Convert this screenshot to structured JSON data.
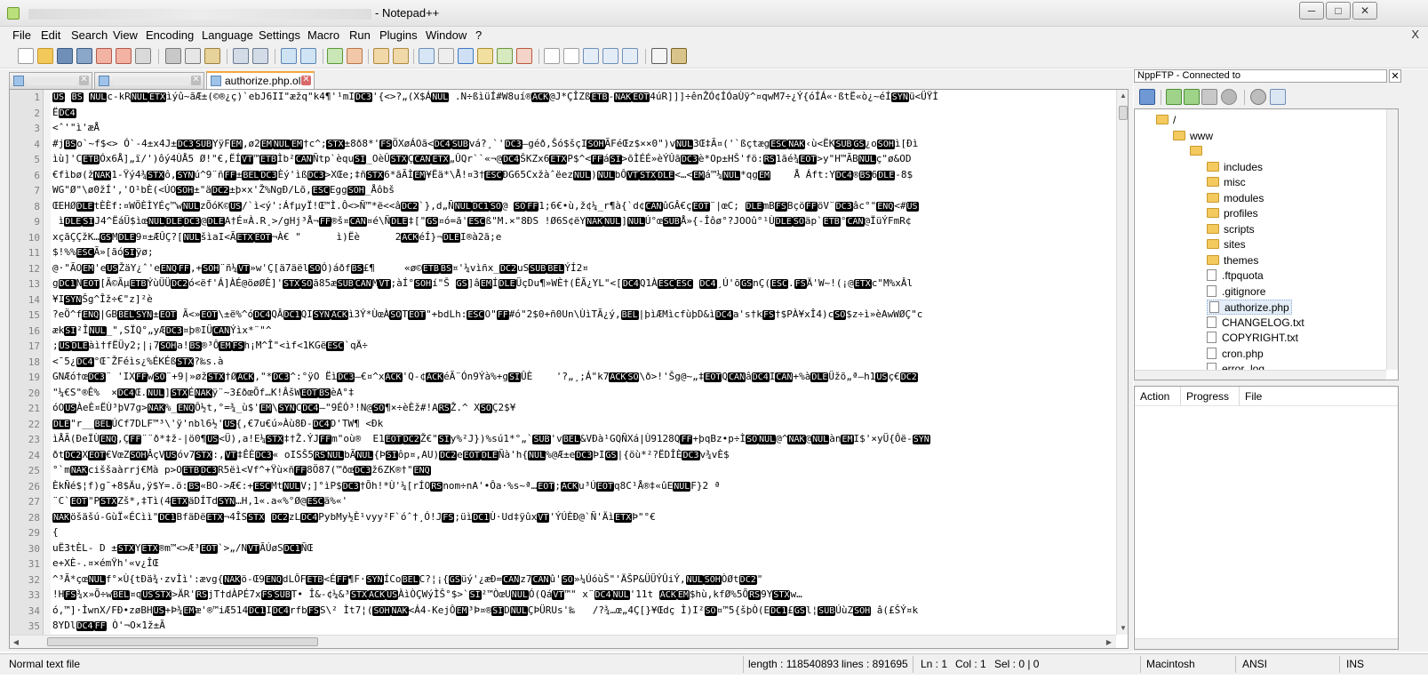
{
  "window": {
    "title_suffix": "- Notepad++",
    "controls": {
      "minimize": "─",
      "maximize": "□",
      "close": "✕"
    }
  },
  "menu": {
    "items": [
      "File",
      "Edit",
      "Search",
      "View",
      "Encoding",
      "Language",
      "Settings",
      "Macro",
      "Run",
      "Plugins",
      "Window",
      "?"
    ],
    "close": "X"
  },
  "toolbar": {
    "icons": [
      "new-file-icon",
      "open-file-icon",
      "save-icon",
      "save-all-icon",
      "close-icon",
      "close-all-icon",
      "print-icon",
      "cut-icon",
      "copy-icon",
      "paste-icon",
      "undo-icon",
      "redo-icon",
      "find-icon",
      "replace-icon",
      "zoom-in-icon",
      "zoom-out-icon",
      "sync-vertical-icon",
      "sync-horizontal-icon",
      "word-wrap-icon",
      "show-all-chars-icon",
      "indent-guide-icon",
      "doc-map-icon",
      "function-list-icon",
      "folder-workspace-icon",
      "monitoring-icon",
      "record-macro-icon",
      "stop-macro-icon",
      "play-macro-icon",
      "run-macro-multiple-icon",
      "save-macro-icon",
      "spellcheck-icon",
      "ftp-icon"
    ]
  },
  "tabs": [
    {
      "label": "",
      "close": "✕",
      "active": false
    },
    {
      "label": "",
      "close": "✕",
      "active": false
    },
    {
      "label": "authorize.php.old",
      "close": "✕",
      "active": true
    }
  ],
  "editor": {
    "lines": [
      {
        "n": "1",
        "t": "US BS NULc-kRNULETXìýû~ãÆ±(©®¿ç)`ebJ6II\"æžq\"k4¶'¹mIDC3'{<>?„(X$ÁNUL .N÷ßìüÍ#W8uí®ACK@J*ÇÎZßETB-NAKEOT4úR]]]÷ênŽÓ¢ÍÓaÙÿ^¤qwM7÷¿Ý{óÍÁ«·ßtË«ò¿~éÍSYNü<ÜŸÌ"
      },
      {
        "n": "2",
        "t": "ËDC4"
      },
      {
        "n": "3",
        "t": "<ˆ'\"ì'æÅ"
      },
      {
        "n": "4",
        "t": "#jBSo`~f$<> Ó`-4±x4J±DC3SUBYÿFEM,ø2EMNULEM†c^;STX±8ð8*'FSÖXøÁOã<DC4SUBvá?¸`'DC3—géð,Šó$šçISOHÃFéŒz$××0\")vNUL3Œ‡Ã¤('`ßçtægESCNAK‹ù<ËKSUBGS¿oSOHì[Ðì"
      },
      {
        "n": "5",
        "t": "ìù]'CETBÓx6Å]„ï/')ôý4ÙÅ5 Ø!\"€,ËÍVT™ETBÌb²CANÑtp`èquSI_OèÛSTXÇCANETX„ÛQr``«¬@DC4ŠKZx6ETXP$^<FFáSI>õÌÉÉ»èÝÛãDC3è*Op±HŠ'fö:RS1ãé¾EOT>y\"H™ÃBNULç\"ø&OD"
      },
      {
        "n": "6",
        "t": "€fìbø(žNAK1-Ÿý4¾STXô,SYNú^9¨ñFF±BELDC3Èý'ìßDC3>XŒe;‡ñSTX6*ãÃÌEM¥Ëä*\\Å!¤3†ESCĐG65CxžàˆëezNUL)NULbÔVTSTXDLE<…<EMá™¼NUL*qgEM    Å Áft:YDC4®BS6DLE-8$"
      },
      {
        "n": "7",
        "t": "WG\"Ø\"\\ø0žÍ'‚'O¹bÈ(<ÚOSOH±\"äDC2±þ×x'Ž%NgÐ/Lõ,ESCEggSOH_Åôbš"
      },
      {
        "n": "8",
        "t": "ŒEHØDLEtÈÈf:¤WÖÈÌYÉç™wNULzÕóK©US/`ì<ý':ÁfµyÏ!Œ™Ì.Ô<>Ñ™*ë<<âDC2`},d„ÑNULDC1SO@ SOFF1;6€•ù,ž¢¼_r¶à{`d¢CANûGÂ€çEOT¨|œC; DLEmBFSBçöFFöV¨DC3âc°\"ENQ<#US"
      },
      {
        "n": "9",
        "t": " ìDLESIJ4^ËáÜ$ìœNULDLEDC3@DLEA†É¤À.R¸>/gHj³Å¬FF®š¤CAN¤é\\ÑDLE‡[\"GS¤ó=ã'ESCß\"M.×\"8ÐS !Ø6S¢ëYNAKNUL]NULÚ°œSUBÅ»{-Îôø°?JOOû°¹ÙDLESOäp`ETB°CAN@ÏüÝFmR¢"
      },
      {
        "n": "10",
        "t": "xçãÇÇžK…GSMDLE9¤±ÆÛÇ?[NULšìaI<ÃETXEOT¬À€ \"      ì)Ëè      2ACKéÍ}¬DLEI®à2ã;e"
      },
      {
        "n": "11",
        "t": "$!%%ESCÃ»[ãóSIÿø; "
      },
      {
        "n": "12",
        "t": "@·\"ÃOEM'eUSŽäY¿ˆ'eENQFF,+SOH¨ñ¼VT»w'Ç[ä7äëlSOÓ)áðfBS£¶     «ø©ETBBS¤'¼vìñx_DC2uSSUBBELÝÍ2¤"
      },
      {
        "n": "13",
        "t": "gDC1NEOT[Ã©ÃµETBÝùÜÜDC2ó<ëf'Á]ÀÉ@öøØÈ]'STXSOã85æSUBCANMVT;àÍ°SOHí\"Š GS]âEMÍDLEÜçDu¶»WÈ†(ËÃ¿YL\"<[DC4Q1ÀESCESC DC4¸Ú'õGSnÇ(ESC.FSÄ'W~!(¡@ETXc\"M%xÂl"
      },
      {
        "n": "14",
        "t": "¥ISYNŠg^Îž÷€\"z]²è"
      },
      {
        "n": "15",
        "t": "?eÖ^fENQ|GBBELSYN±EOT Ã<»EOT\\±ë%^óDC4QÂDC1QISYNACKì3Ý*ÙœÀSOTEOT\"+bdLh:ESCO\"FF#ó\"2$0+ñ0Un\\ÙìTÃ¿ý,BEL|þìÆMìcfùþD&ìDC4a's†kFS†$PÀ¥xÎ4)cSO$z÷ì»èAwWØÇ\"c"
      },
      {
        "n": "16",
        "t": "ækSI²ÎNUL_\",SÏQ°„yÆDC3¤þ®IÜCANÝìx*¨\"^"
      },
      {
        "n": "17",
        "t": ";USDLEàì†fËÜy2;|¡7SOHa!BS®³ÔEMFSh¡M^Î\"<ìf<1KGëESC`qÄ÷"
      },
      {
        "n": "18",
        "t": "<¯5¿DC4°Œ¯ŽFéìs¿%ÉKÉßSTX?‰s.à"
      },
      {
        "n": "19",
        "t": "GNÆó†œDC3¨ 'IXFFwSO¨+9|»øžSTX†ØACK,\"*DC3^:°ÿO ËìDC3—€¤^xACK'Q-¢ACKéÃ¨Ón9Ýà%+gSIÛÈ    '?„¸;Á\"k7ACKSO\\ð>!'Šg@~„‡EOTQCANâDC4ICAN+%àDLEÜžõ„ª—h1USç€DC2"
      },
      {
        "n": "20",
        "t": "\"¼€S\"®Ê%  ×DC4Œ.NUL]STXÉNAKÿ¨~3£ðœÕf…K!ÂšWEOTBSèA°‡"
      },
      {
        "n": "21",
        "t": "óOUSÀeÈ¤ËÙ³þV7g>NAK%_ENQÔ½t,°=¾_ù$'EM\\SYNCDC4—\"9ÉÓ³!N@SO¶×÷èÈž#!ARSŽ.^ XSOÇ2$¥"
      },
      {
        "n": "22",
        "t": "DLE\"r__BELÚCf7DLF™³\\'ÿ'nbl6½'US{,€7u€ú»Àù8Ð-DC4D'TW¶ <Ðk"
      },
      {
        "n": "23",
        "t": "ìÅÃ(ÐeÏÙENQ,ÇFF¨¨ð*‡ž-|ö0¶US<Ü),a!E¼STX‡†Ž.ÝJFFm\"où®  E1EOTDC2Ž€\"SIy%²J})%sú1*°„`SUB'vBEL&VÐà¹GQÑXá|Ù9128QFF+þqBz•p÷ÌSONUL@^NAK@NULànEMI$'×yÜ{Ôë-SYN"
      },
      {
        "n": "24",
        "t": "ðtDC2XEOT€VœZSOHÂçVUSóv7STX:,VT‡ÊÈDC3« oISŠ5RSNULbÃNUL{ÞSIôp¤,AU)DC2eEOTDLEÑà'h{NUL%@Æ±eDC3ÞIGS|{öù*²?ËDÎÈDC3v¾vÈ$"
      },
      {
        "n": "25",
        "t": "°`mNAKciššaàrrj€Mà p>OETBDC3R5ëì<Vf^+Ÿù×ñFF8Ö87(™ðœDC3ž6ZK®†\"ENQ"
      },
      {
        "n": "26",
        "t": "ÈkÑé$¦f)g¯+8$Äu,ÿ$Y=.ö:BS«BO->Æ€:+ESCMtNULV;]°ìP$DC3†Õh!*Ù'¼[rÍORSnom÷nA'•Ôa·%s~ª…EOT;ACKu³ÚEOTq8C¹Å®‡«ûENULF}2 ª"
      },
      {
        "n": "27",
        "t": "¨C`EOT\"PSTXZš*,‡Tì(4ETXäDÍTdSYN…H,1«.a«%°Ø@ESCä%«'"
      },
      {
        "n": "28",
        "t": "NAKöšäšú-GùÏ«ÉCìì\"DC1BfäÐëETX¬4ÎSSTX DC2zLDC4PybMy½È¹vyy²F`óˆ†¸Ó!JFS;üìDC1Ù·Ud‡ÿûxVT'ÝÚÈÐ@`Ñ'ÄìETXÞ\"°€"
      },
      {
        "n": "29",
        "t": "{"
      },
      {
        "n": "30",
        "t": "uË3tÈL- D ±STXYETX®m™<>Æ³EOT`>„/NVTÃÚøSDC1ÑŒ"
      },
      {
        "n": "31",
        "t": "e+XÈ-.¤×émŸh'«v¿ÎŒ"
      },
      {
        "n": "32",
        "t": "^³Ã*çœNULf°×Ù{tÐä¾·zvÌì':ævg{NAKö-Œ9ENQdLÔFETB<ÉFF¶F·SYNÍCoBELC?¦¡{GSüý'¿æÐ=CANz7CANû'SO»¼ÚóùŠ\"'ÄŠP&ÜÜÝÛiÝ,NULSOHÒØtDC2\""
      },
      {
        "n": "33",
        "t": "!HFS¾x»Õ÷wBEL¤qUSSTX>ÄR'RSjT†dÀPÉ7xFSSUBT• Î&-¢¼&³STXACKUSÀìÒÇWýÌŠ°$>`SI²™ÒœUNULÓ(QáVT™\" x¨DC4NUL'11t ACKEM$hù,kfØ%5ÕRS9YSTXw…"
      },
      {
        "n": "34",
        "t": "ó,™]·ÌwnX/FÐ•zøBHUS+Þ¾EMæ'®™iÆ514DC1IDC4rfbFSS\\² Ìt7¦(SOHNAK<Á4-KejÔEM³Þ¤®SIDNULÇÞÜRUs'‰   /?¾…œ„4Ç[}¥Œdç Ì)I²SO¤™5{šþÒ(EDC1£GSl¦SUBÚùZSOH â(£ŠÝ¤k"
      },
      {
        "n": "35",
        "t": "8YDlDC4FF Ò'¬O×1ž±Ã"
      }
    ]
  },
  "ftp": {
    "header": "NppFTP - Connected to",
    "close": "✕",
    "toolbar_icons": [
      "connect-icon",
      "download-icon",
      "upload-icon",
      "refresh-icon",
      "abort-icon",
      "settings-icon",
      "message-window-icon"
    ],
    "tree": [
      {
        "label": "/",
        "type": "folder",
        "depth": 0
      },
      {
        "label": "www",
        "type": "folder",
        "depth": 1
      },
      {
        "label": "",
        "type": "folder",
        "depth": 2
      },
      {
        "label": "includes",
        "type": "folder",
        "depth": 3
      },
      {
        "label": "misc",
        "type": "folder",
        "depth": 3
      },
      {
        "label": "modules",
        "type": "folder",
        "depth": 3
      },
      {
        "label": "profiles",
        "type": "folder",
        "depth": 3
      },
      {
        "label": "scripts",
        "type": "folder",
        "depth": 3
      },
      {
        "label": "sites",
        "type": "folder",
        "depth": 3
      },
      {
        "label": "themes",
        "type": "folder",
        "depth": 3
      },
      {
        "label": ".ftpquota",
        "type": "file",
        "depth": 3
      },
      {
        "label": ".gitignore",
        "type": "file",
        "depth": 3
      },
      {
        "label": "authorize.php",
        "type": "file",
        "depth": 3,
        "selected": true
      },
      {
        "label": "CHANGELOG.txt",
        "type": "file",
        "depth": 3
      },
      {
        "label": "COPYRIGHT.txt",
        "type": "file",
        "depth": 3
      },
      {
        "label": "cron.php",
        "type": "file",
        "depth": 3
      },
      {
        "label": "error_log",
        "type": "file",
        "depth": 3
      }
    ],
    "queue_headers": [
      "Action",
      "Progress",
      "File"
    ]
  },
  "statusbar": {
    "type": "Normal text file",
    "length": "length : 118540893",
    "lines": "lines : 891695",
    "ln": "Ln : 1",
    "col": "Col : 1",
    "sel": "Sel : 0 | 0",
    "eol": "Macintosh",
    "encoding": "ANSI",
    "mode": "INS"
  }
}
